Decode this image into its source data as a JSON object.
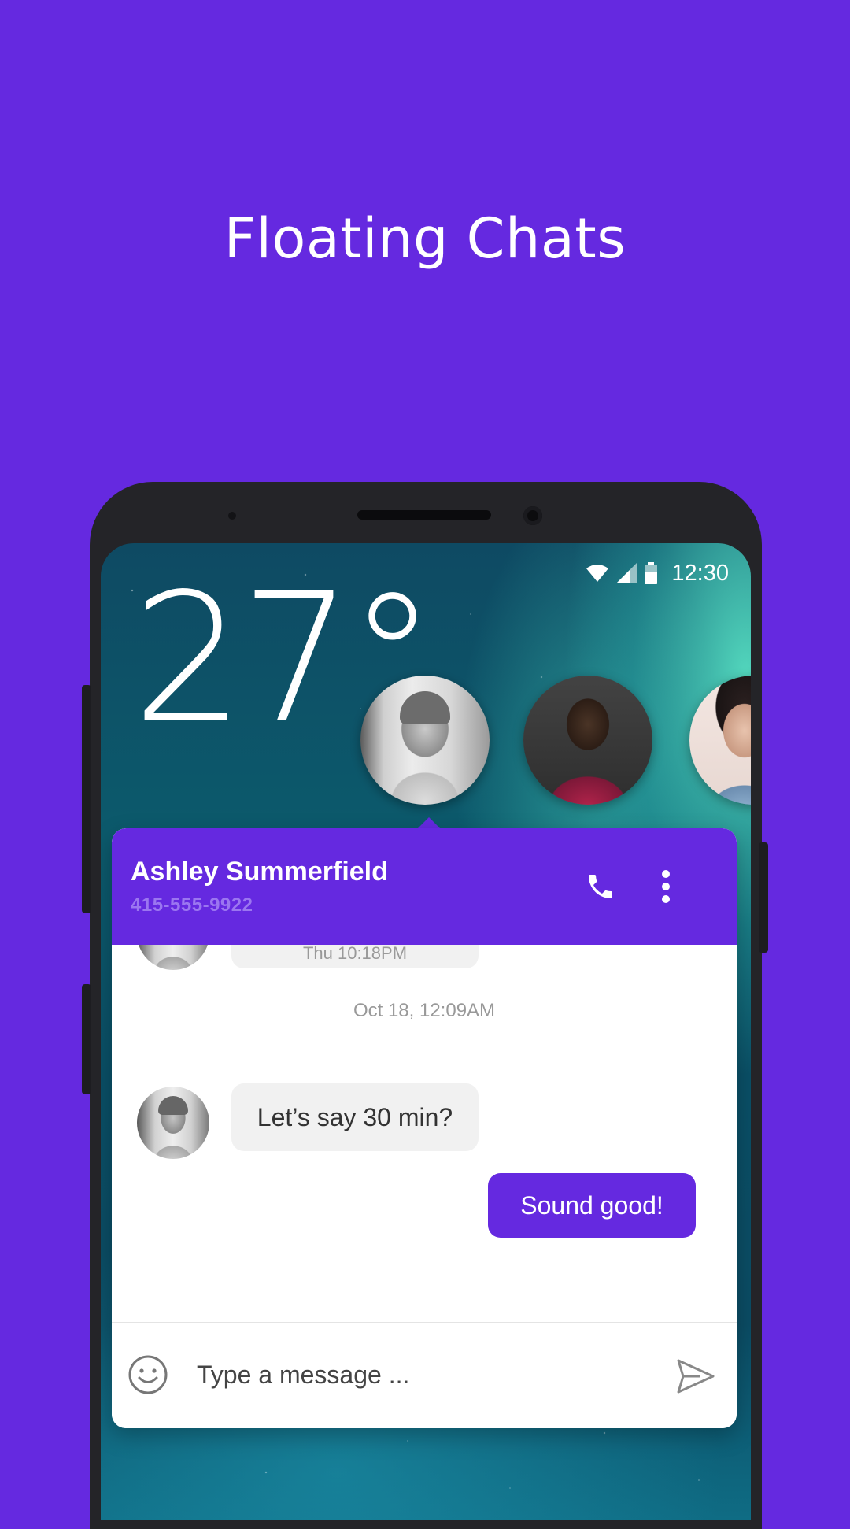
{
  "headline": "Floating Chats",
  "status_bar": {
    "time": "12:30",
    "icons": [
      "wifi-icon",
      "signal-icon",
      "battery-icon"
    ]
  },
  "weather": {
    "temperature": "27°"
  },
  "chat_heads": [
    {
      "name": "chat-head-ashley",
      "active": true
    },
    {
      "name": "chat-head-2",
      "active": false
    },
    {
      "name": "chat-head-3",
      "active": false
    }
  ],
  "chat": {
    "contact_name": "Ashley Summerfield",
    "contact_phone": "415-555-9922",
    "messages": [
      {
        "direction": "in",
        "meta": "Thu 10:18PM"
      },
      {
        "type": "date",
        "text": "Oct 18, 12:09AM"
      },
      {
        "direction": "in",
        "text": "Let’s say 30 min?"
      },
      {
        "direction": "out",
        "text": "Sound good!"
      }
    ],
    "input_placeholder": "Type a message ..."
  },
  "colors": {
    "accent": "#6529e0",
    "incoming_bubble": "#f1f1f1",
    "meta_text": "#999999"
  }
}
